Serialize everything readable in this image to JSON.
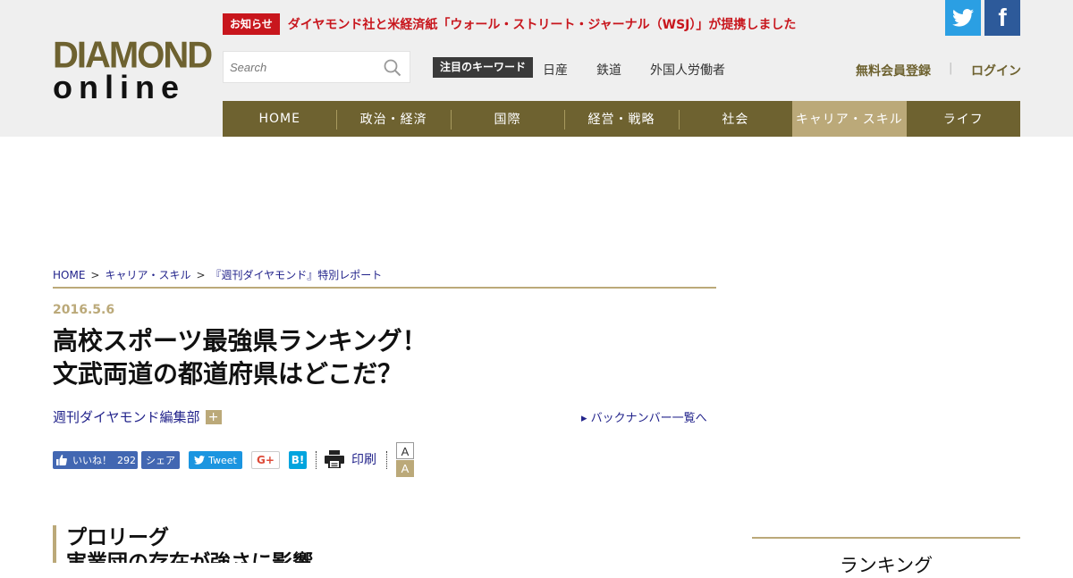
{
  "logo": {
    "line1": "DIAMOND",
    "line2": "online"
  },
  "notice": {
    "badge": "お知らせ",
    "text": "ダイヤモンド社と米経済紙「ウォール・ストリート・ジャーナル（WSJ）」が提携しました"
  },
  "social": {
    "twitter_icon": "twitter-icon",
    "facebook_glyph": "f"
  },
  "search": {
    "placeholder": "Search"
  },
  "keywords": {
    "label": "注目のキーワード",
    "items": [
      "日産",
      "鉄道",
      "外国人労働者"
    ]
  },
  "account": {
    "register": "無料会員登録",
    "separator": "|",
    "login": "ログイン"
  },
  "nav": [
    "HOME",
    "政治・経済",
    "国際",
    "経営・戦略",
    "社会",
    "キャリア・スキル",
    "ライフ"
  ],
  "breadcrumb": {
    "items": [
      "HOME",
      "キャリア・スキル",
      "『週刊ダイヤモンド』特別レポート"
    ],
    "separator": ">"
  },
  "article": {
    "date": "2016.5.6",
    "title_line1": "高校スポーツ最強県ランキング！",
    "title_line2": "文武両道の都道府県はどこだ？",
    "author": "週刊ダイヤモンド編集部",
    "author_more": "+",
    "backnumber": "▸ バックナンバー一覧へ"
  },
  "share": {
    "like_label": "いいね！",
    "like_count": "292",
    "share_label": "シェア",
    "tweet_label": "Tweet",
    "gplus_label": "G+",
    "hatena_label": "B!",
    "print_label": "印刷",
    "font_small": "A",
    "font_large": "A"
  },
  "section": {
    "line1": "プロリーグ",
    "line2": "実業団の存在が強さに影響"
  },
  "sidebar": {
    "ranking_title": "ランキング"
  },
  "colors": {
    "brand_gold": "#6e6230",
    "accent_light": "#bba979",
    "notice_red": "#c8161d",
    "link_blue": "#22238b"
  }
}
